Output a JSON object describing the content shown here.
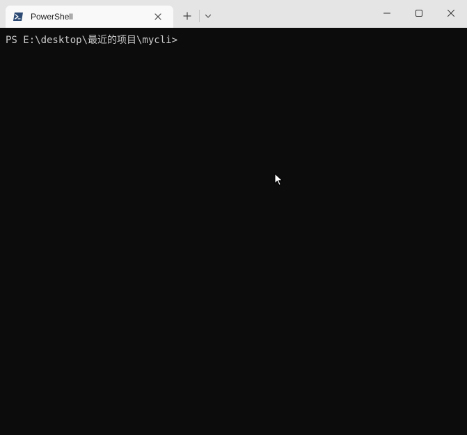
{
  "tab": {
    "title": "PowerShell",
    "icon": "powershell-icon"
  },
  "titlebar": {
    "new_tab_icon": "plus-icon",
    "dropdown_icon": "chevron-down-icon",
    "minimize_icon": "minimize-icon",
    "maximize_icon": "maximize-icon",
    "close_icon": "close-icon"
  },
  "terminal": {
    "prompt": "PS E:\\desktop\\最近的项目\\mycli>"
  },
  "colors": {
    "titlebar_bg": "#e5e5e5",
    "tab_bg": "#f9f9f9",
    "terminal_bg": "#0c0c0c",
    "terminal_fg": "#cccccc",
    "powershell_blue": "#012456"
  }
}
